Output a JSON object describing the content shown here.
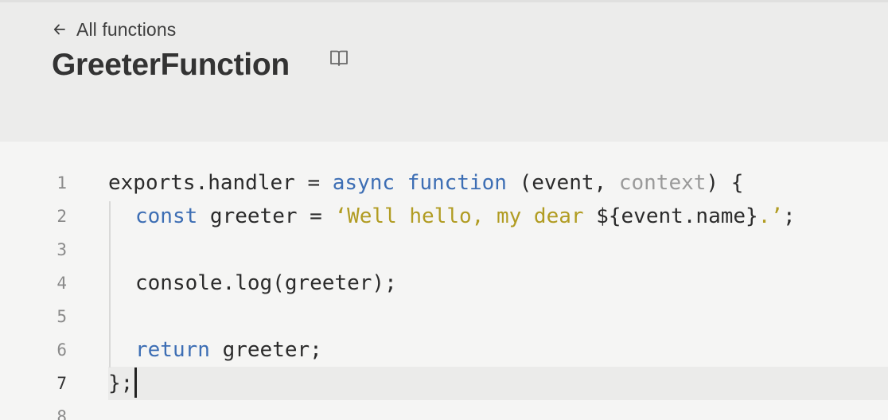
{
  "header": {
    "back_label": "All functions",
    "title": "GreeterFunction",
    "back_icon": "arrow-left-icon",
    "docs_icon": "book-open-icon"
  },
  "editor": {
    "lines": [
      {
        "num": "1",
        "tokens": [
          "exports.handler = ",
          "async",
          " ",
          "function",
          " (event, ",
          "context",
          ") {"
        ]
      },
      {
        "num": "2",
        "tokens": [
          "const",
          " greeter = ",
          "‘Well hello, my dear ",
          "${event.name}",
          ".’",
          ";"
        ]
      },
      {
        "num": "3",
        "tokens": []
      },
      {
        "num": "4",
        "tokens": [
          "console.log(greeter);"
        ]
      },
      {
        "num": "5",
        "tokens": []
      },
      {
        "num": "6",
        "tokens": [
          "return",
          " greeter;"
        ]
      },
      {
        "num": "7",
        "tokens": [
          "};"
        ]
      },
      {
        "num": "8",
        "tokens": []
      }
    ],
    "active_line": "7"
  },
  "colors": {
    "keyword": "#3d6eb4",
    "string": "#b19c22",
    "muted": "#9a9a9a",
    "text": "#2b2b2b",
    "header_bg": "#ececeb",
    "editor_bg": "#f5f5f4"
  }
}
